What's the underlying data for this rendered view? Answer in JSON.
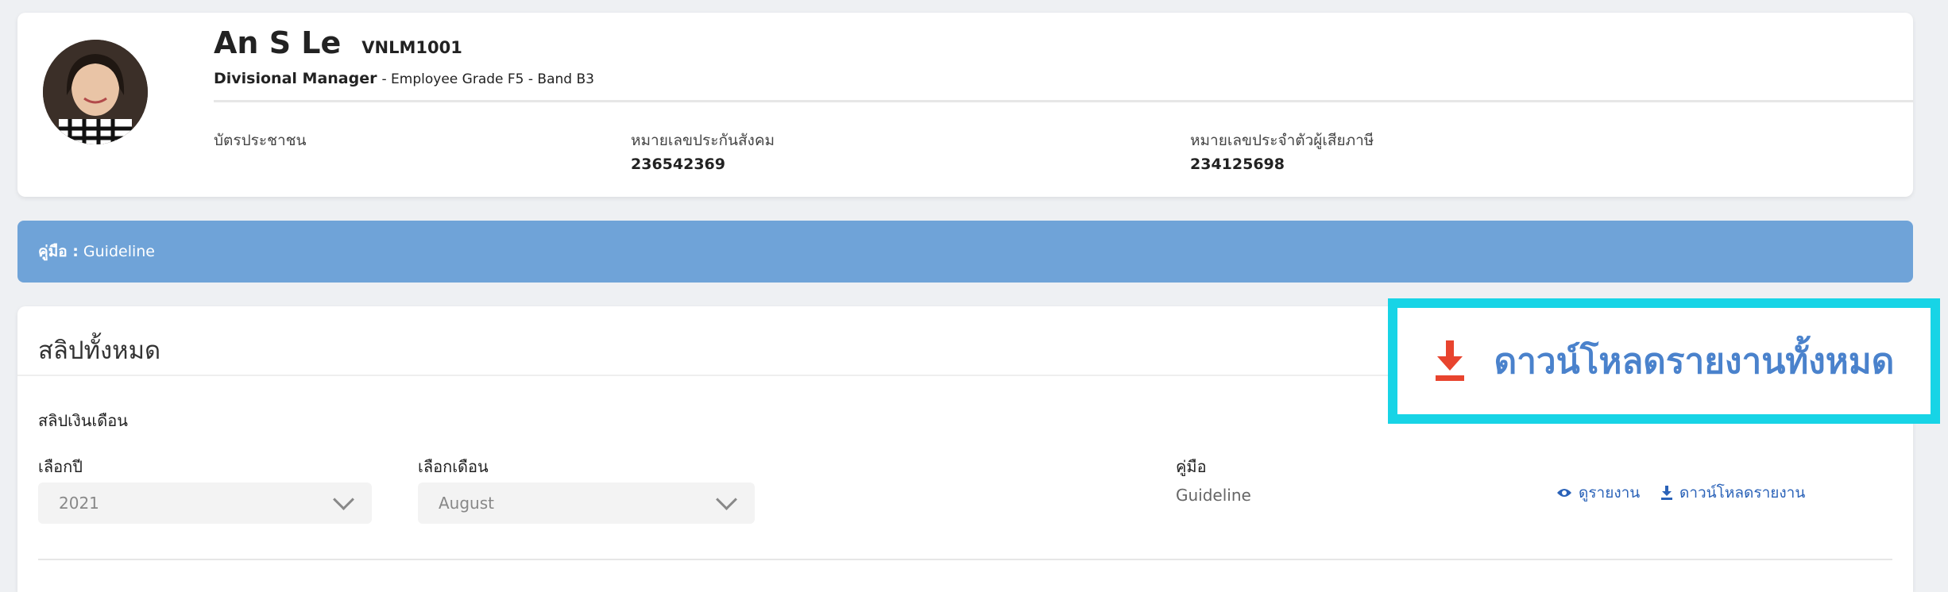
{
  "profile": {
    "name": "An S Le",
    "code": "VNLM1001",
    "position": "Divisional Manager",
    "grade_band": "- Employee Grade F5 - Band B3",
    "id_card_label": "บัตรประชาชน",
    "social_security_label": "หมายเลขประกันสังคม",
    "social_security_value": "236542369",
    "tax_id_label": "หมายเลขประจำตัวผู้เสียภาษี",
    "tax_id_value": "234125698"
  },
  "guide_bar": {
    "label": "คู่มือ :",
    "value": "Guideline"
  },
  "slips": {
    "title": "สลิปทั้งหมด",
    "download_all_label": "ดาวน์โหลดรายงานทั้งหมด",
    "subtitle": "สลิปเงินเดือน",
    "year_label": "เลือกปี",
    "year_value": "2021",
    "month_label": "เลือกเดือน",
    "month_value": "August",
    "guide_label": "คู่มือ",
    "guide_value": "Guideline",
    "view_report": "ดูรายงาน",
    "download_report": "ดาวน์โหลดรายงาน"
  },
  "colors": {
    "guide_bar_bg": "#6fa3d8",
    "highlight_border": "#17d4e6",
    "download_icon": "#e8442e",
    "link": "#2a62b8"
  },
  "icons": {
    "download_all": "download-icon",
    "view": "eye-icon",
    "download": "download-icon",
    "select": "chevron-down-icon"
  }
}
